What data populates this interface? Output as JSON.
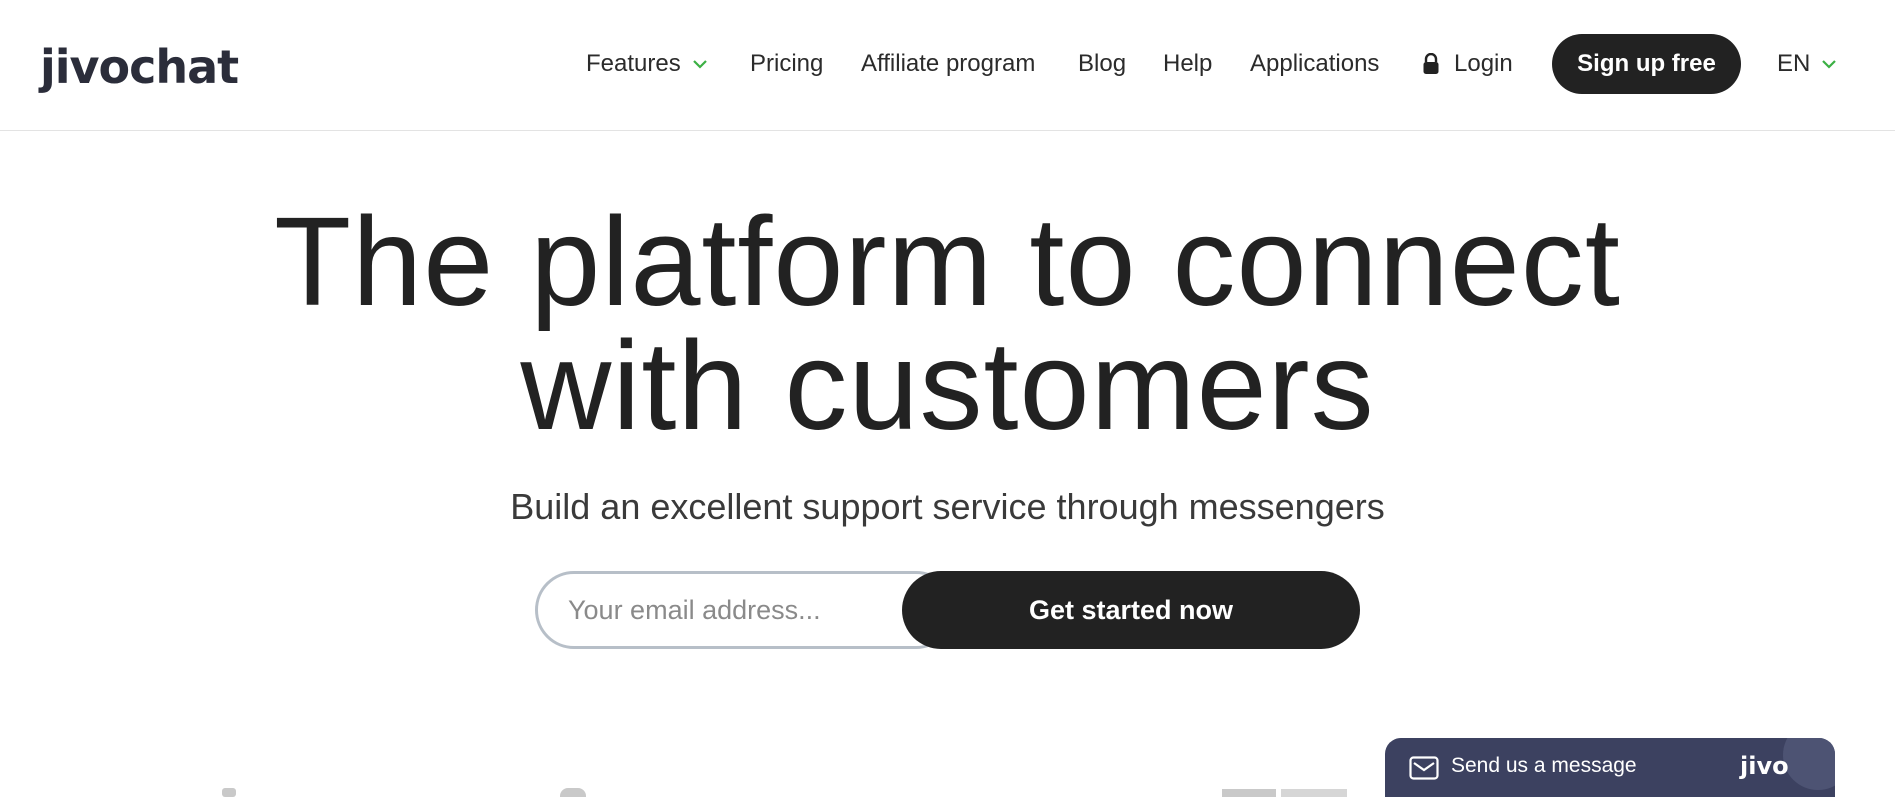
{
  "brand": {
    "logo_text": "jivochat",
    "accent_color": "#3cb044",
    "dark_color": "#222222"
  },
  "nav": {
    "features": "Features",
    "pricing": "Pricing",
    "affiliate": "Affiliate program",
    "blog": "Blog",
    "help": "Help",
    "applications": "Applications",
    "login": "Login",
    "signup": "Sign up free",
    "language": "EN",
    "icons": [
      "chevron-down-icon",
      "lock-icon"
    ]
  },
  "hero": {
    "title_line1": "The platform to connect",
    "title_line2": "with customers",
    "subtitle": "Build an excellent support service through messengers",
    "email_placeholder": "Your email address...",
    "cta": "Get started now"
  },
  "chat_widget": {
    "label": "Send us a message",
    "brand": "jivo",
    "background": "#3c4160",
    "icon": "envelope-icon"
  }
}
